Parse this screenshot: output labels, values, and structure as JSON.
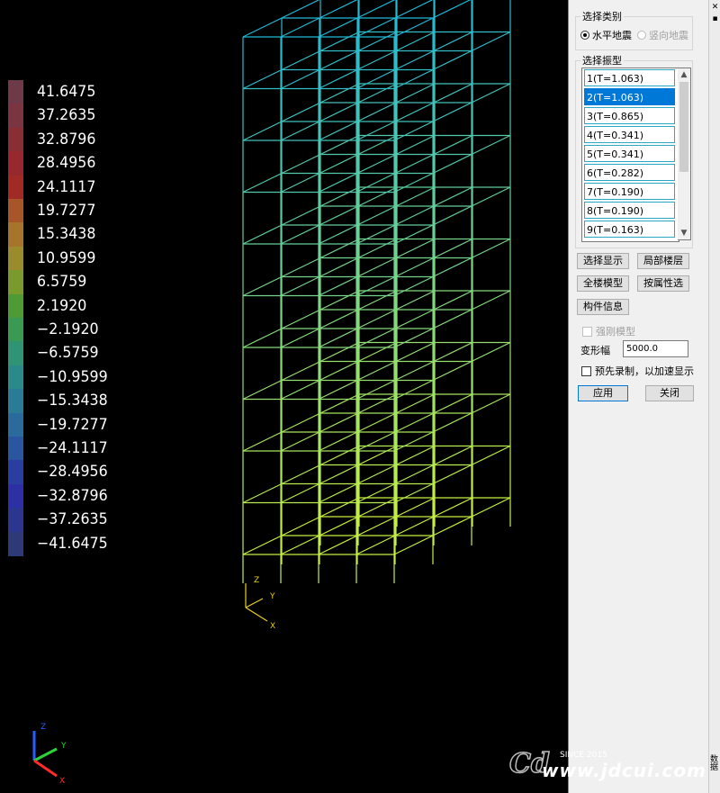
{
  "legend": {
    "values": [
      "41.6475",
      "37.2635",
      "32.8796",
      "28.4956",
      "24.1117",
      "19.7277",
      "15.3438",
      "10.9599",
      "6.5759",
      "2.1920",
      "-2.1920",
      "-6.5759",
      "-10.9599",
      "-15.3438",
      "-19.7277",
      "-24.1117",
      "-28.4956",
      "-32.8796",
      "-37.2635",
      "-41.6475"
    ],
    "colors": [
      "#6e3a4a",
      "#7a3540",
      "#8a2e36",
      "#96282e",
      "#a12a24",
      "#a8552a",
      "#a6742a",
      "#9a8c2c",
      "#7a9a2e",
      "#4e9a36",
      "#3a9a52",
      "#2e9474",
      "#2a8a8a",
      "#2a7c96",
      "#2a6a9c",
      "#2a56a0",
      "#2a3ea2",
      "#2c30a4",
      "#2a3690",
      "#2e3a78"
    ]
  },
  "model_axes": {
    "z": "Z",
    "y": "Y",
    "x": "X"
  },
  "corner_axes": {
    "z": "Z",
    "y": "Y",
    "x": "X",
    "colors": {
      "z": "#2a5cff",
      "y": "#2ad43a",
      "x": "#ff2a2a"
    }
  },
  "model_colors": {
    "top": "#20b8d8",
    "bottom": "#c8f040"
  },
  "panel": {
    "category_group": {
      "title": "选择类别",
      "options": [
        {
          "label": "水平地震",
          "selected": true,
          "enabled": true
        },
        {
          "label": "竖向地震",
          "selected": false,
          "enabled": false
        }
      ]
    },
    "mode_group": {
      "title": "选择振型",
      "modes": [
        "1(T=1.063)",
        "2(T=1.063)",
        "3(T=0.865)",
        "4(T=0.341)",
        "5(T=0.341)",
        "6(T=0.282)",
        "7(T=0.190)",
        "8(T=0.190)",
        "9(T=0.163)"
      ],
      "selected_index": 1
    },
    "buttons": {
      "select_display": "选择显示",
      "partial_floor": "局部楼层",
      "full_model": "全楼模型",
      "by_attribute": "按属性选",
      "member_info": "构件信息",
      "apply": "应用",
      "close": "关闭"
    },
    "rigid_model": {
      "label": "强刚模型",
      "checked": false,
      "enabled": false
    },
    "deform_amp": {
      "label": "变形幅",
      "value": "5000.0"
    },
    "prerecord": {
      "label": "预先录制，以加速显示",
      "checked": false
    }
  },
  "edge": {
    "close_glyph": "✕",
    "pin_glyph": "▪",
    "side_label": "数据"
  },
  "watermark": {
    "since": "SINCE 2015",
    "url": "www.jdcui.com",
    "logo": "Cd"
  }
}
